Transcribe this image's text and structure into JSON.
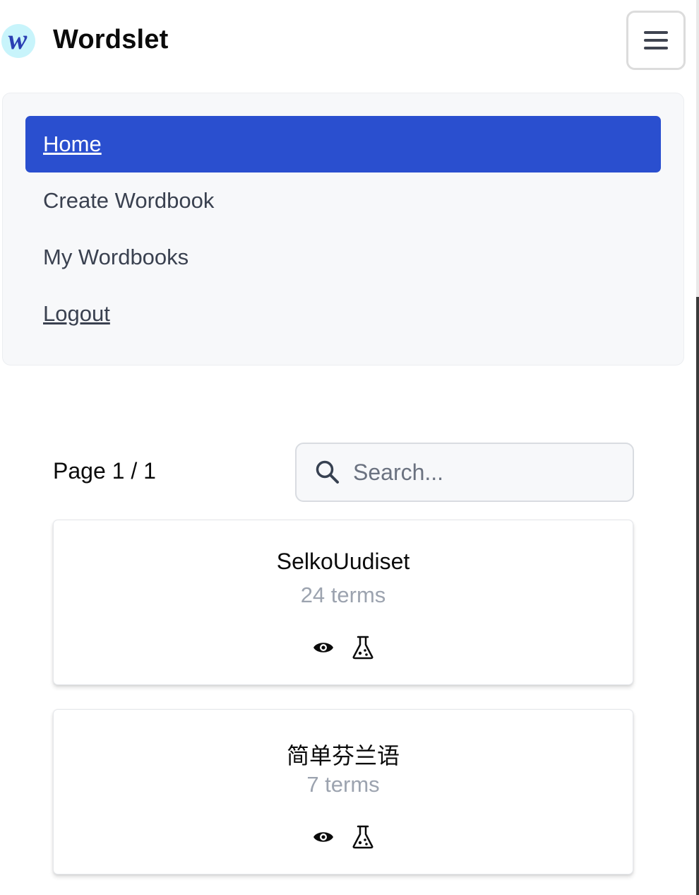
{
  "header": {
    "logo_letter": "w",
    "brand": "Wordslet",
    "menu_icon": "hamburger-icon"
  },
  "nav": {
    "items": [
      {
        "label": "Home",
        "active": true
      },
      {
        "label": "Create Wordbook",
        "active": false
      },
      {
        "label": "My Wordbooks",
        "active": false
      },
      {
        "label": "Logout",
        "active": false
      }
    ]
  },
  "pagination": {
    "label": "Page 1 / 1"
  },
  "search": {
    "placeholder": "Search...",
    "value": ""
  },
  "wordbooks": [
    {
      "title": "SelkoUudiset",
      "terms": "24 terms",
      "actions": [
        "eye-icon",
        "flask-icon"
      ]
    },
    {
      "title": "简单芬兰语",
      "terms": "7 terms",
      "actions": [
        "eye-icon",
        "flask-icon"
      ]
    }
  ],
  "colors": {
    "accent": "#2a4fcf",
    "nav_bg": "#f7f8fa",
    "muted_text": "#9ca3af",
    "logo_bg": "#c8f4fb"
  }
}
